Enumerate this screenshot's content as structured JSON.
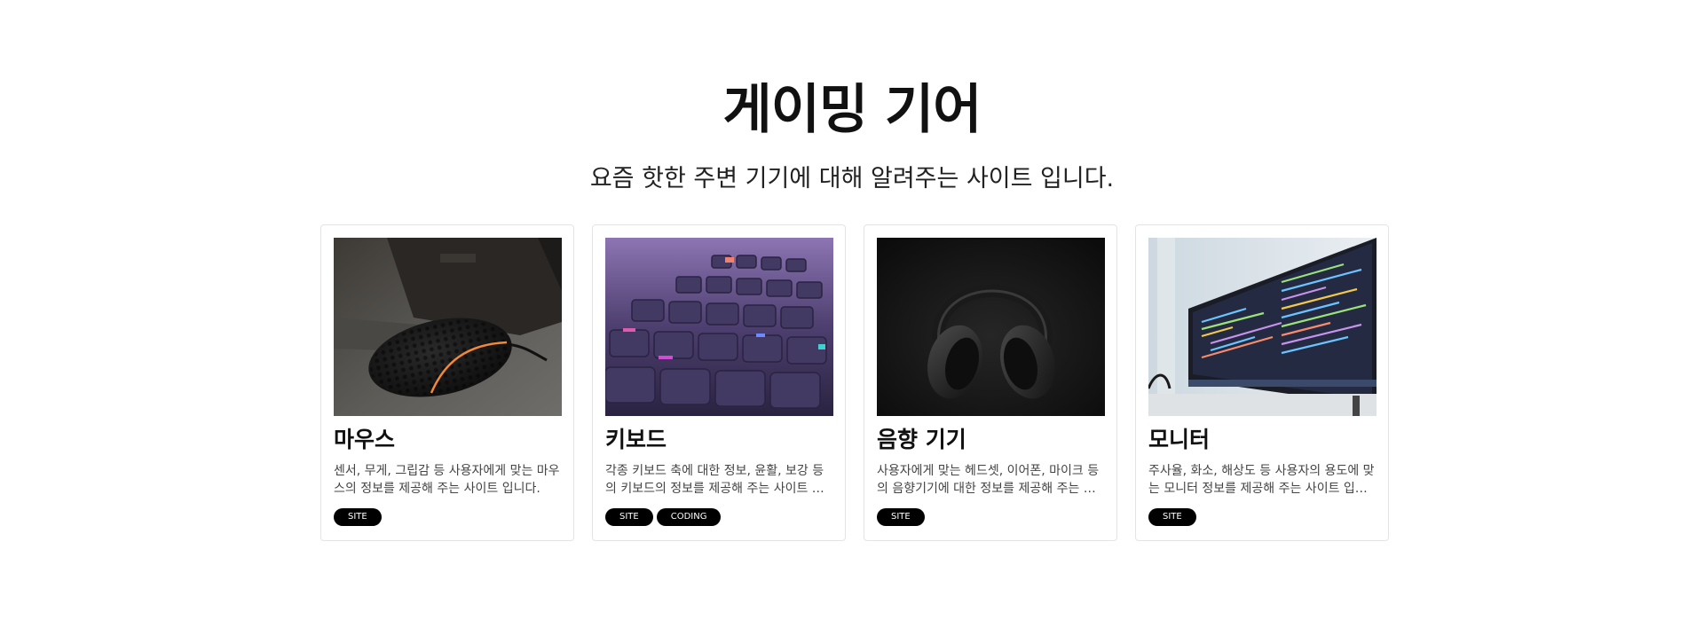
{
  "header": {
    "title": "게이밍 기어",
    "subtitle": "요즘 핫한 주변 기기에 대해 알려주는 사이트 입니다."
  },
  "cards": [
    {
      "title": "마우스",
      "description": "센서, 무게, 그립감 등 사용자에게 맞는 마우스의 정보를 제공해 주는 사이트 입니다.",
      "image_icon": "gaming-mouse-photo",
      "tags": [
        "SITE"
      ]
    },
    {
      "title": "키보드",
      "description": "각종 키보드 축에 대한 정보, 윤활, 보강 등의 키보드의 정보를 제공해 주는 사이트 입니다.",
      "image_icon": "keyboard-photo",
      "tags": [
        "SITE",
        "CODING"
      ]
    },
    {
      "title": "음향 기기",
      "description": "사용자에게 맞는 헤드셋, 이어폰, 마이크 등의 음향기기에 대한 정보를 제공해 주는 사이트 입니다.",
      "image_icon": "headphones-photo",
      "tags": [
        "SITE"
      ]
    },
    {
      "title": "모니터",
      "description": "주사율, 화소, 해상도 등 사용자의 용도에 맞는 모니터 정보를 제공해 주는 사이트 입니다.",
      "image_icon": "monitor-photo",
      "tags": [
        "SITE"
      ]
    }
  ],
  "colors": {
    "tag_background": "#000000",
    "tag_text": "#ffffff",
    "card_border": "#e4e4e4"
  }
}
